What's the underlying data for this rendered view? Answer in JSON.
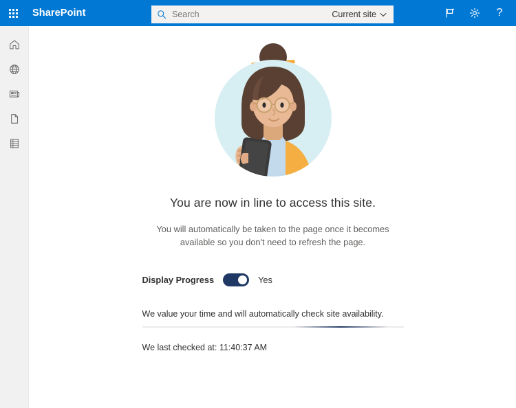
{
  "header": {
    "waffle_icon": "app-launcher-waffle-icon",
    "brand": "SharePoint",
    "search": {
      "icon": "search-icon",
      "placeholder": "Search",
      "value": "",
      "scope_label": "Current site",
      "scope_chevron_icon": "chevron-down-icon"
    },
    "actions": [
      {
        "name": "flag-icon",
        "label": ""
      },
      {
        "name": "gear-icon",
        "label": ""
      },
      {
        "name": "help-icon",
        "label": "?"
      }
    ],
    "background_color": "#0078d4"
  },
  "sidebar": {
    "items": [
      {
        "name": "sidebar-item-home",
        "icon": "home-icon"
      },
      {
        "name": "sidebar-item-world",
        "icon": "globe-icon"
      },
      {
        "name": "sidebar-item-news",
        "icon": "news-icon"
      },
      {
        "name": "sidebar-item-page",
        "icon": "page-icon"
      },
      {
        "name": "sidebar-item-lists",
        "icon": "lists-icon"
      }
    ],
    "background_color": "#f1f1f1"
  },
  "main": {
    "illustration": {
      "name": "person-with-phone-illustration",
      "circle_color": "#d7eff2",
      "hair_color": "#5a4033",
      "jacket_color": "#f5ae41",
      "shirt_color": "#c3d9ec",
      "skin_color": "#e8b994",
      "phone_color": "#3a3a3a"
    },
    "headline": "You are now in line to access this site.",
    "subline": "You will automatically be taken to the page once it becomes available so you don't need to refresh the page.",
    "display_progress": {
      "label": "Display Progress",
      "state": "Yes",
      "checked": true,
      "on_color": "#1f3864"
    },
    "footer_note": "We value your time and will automatically check site availability.",
    "progress_bar": {
      "name": "indeterminate-progress-bar",
      "track_color": "#edebe9",
      "fill_color": "#1f3864"
    },
    "last_checked": "We last checked at: 11:40:37 AM"
  }
}
